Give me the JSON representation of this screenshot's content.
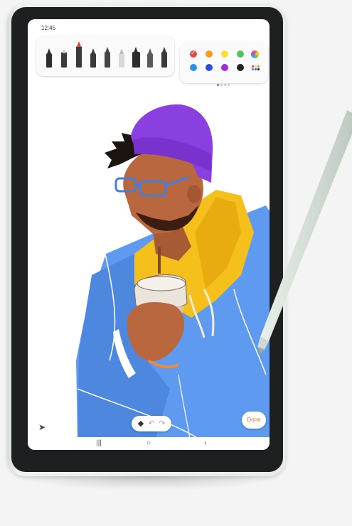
{
  "status_bar": {
    "time": "12:45"
  },
  "pen_tools": [
    {
      "name": "pen-tool-1",
      "color": "#3a3a3a"
    },
    {
      "name": "pen-tool-2",
      "color": "#8a8a8a"
    },
    {
      "name": "pen-tool-3",
      "color": "#e0422b"
    },
    {
      "name": "pen-tool-4",
      "color": "#3a3a3a"
    },
    {
      "name": "pen-tool-5",
      "color": "#444444"
    },
    {
      "name": "pen-tool-6",
      "color": "#bcbcbc"
    },
    {
      "name": "pen-tool-7",
      "color": "#2e2e2e"
    },
    {
      "name": "pen-tool-8",
      "color": "#5a5a5a"
    },
    {
      "name": "pen-tool-9",
      "color": "#3a3a3a"
    }
  ],
  "color_palette": {
    "swatches": [
      {
        "color": "#e8473c",
        "selected": true
      },
      {
        "color": "#ff9a1f",
        "selected": false
      },
      {
        "color": "#ffdd33",
        "selected": false
      },
      {
        "color": "#52c35a",
        "selected": false
      },
      {
        "color": "#2f8fe6",
        "selected": false
      },
      {
        "color": "#2a4fd6",
        "selected": false
      },
      {
        "color": "#9b2fd6",
        "selected": false
      },
      {
        "color": "#222222",
        "selected": false
      }
    ],
    "icons": [
      "color-wheel-icon",
      "palette-grid-icon"
    ]
  },
  "bottom_controls": {
    "share_icon": "share-icon",
    "eraser_icon": "eraser-icon",
    "undo_icon": "undo-icon",
    "redo_icon": "redo-icon",
    "done_label": "Done"
  },
  "system_nav": {
    "recents_glyph": "|||",
    "home_glyph": "○",
    "back_glyph": "‹"
  },
  "colors": {
    "accent": "#ff6a2a",
    "beanie": "#8a3fe0",
    "hoodie": "#f6c01c",
    "jacket": "#5e9bf0",
    "skin": "#b9673f"
  }
}
